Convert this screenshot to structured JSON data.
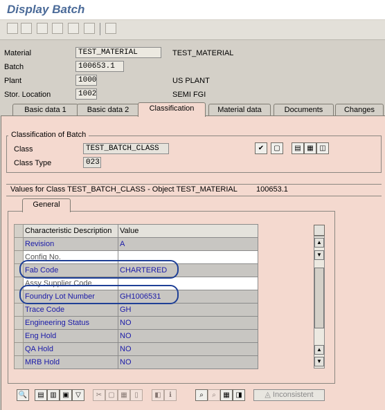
{
  "title": "Display Batch",
  "header": {
    "material_label": "Material",
    "material_value": "TEST_MATERIAL",
    "material_desc": "TEST_MATERIAL",
    "batch_label": "Batch",
    "batch_value": "100653.1",
    "plant_label": "Plant",
    "plant_value": "1000",
    "plant_desc": "US PLANT",
    "storloc_label": "Stor. Location",
    "storloc_value": "1002",
    "storloc_desc": "SEMI FGI"
  },
  "tabs": [
    "Basic data 1",
    "Basic data 2",
    "Classification",
    "Material data",
    "Documents",
    "Changes"
  ],
  "active_tab": "Classification",
  "classification": {
    "group_title": "Classification of Batch",
    "class_label": "Class",
    "class_value": "TEST_BATCH_CLASS",
    "class_type_label": "Class Type",
    "class_type_value": "023"
  },
  "values_line": {
    "text": "Values for Class TEST_BATCH_CLASS - Object TEST_MATERIAL",
    "batch": "100653.1"
  },
  "general_tab": "General",
  "table": {
    "headers": [
      "Characteristic Description",
      "Value"
    ],
    "rows": [
      {
        "desc": "Revision",
        "value": "A"
      },
      {
        "desc": "Config No.",
        "value": ""
      },
      {
        "desc": "Fab Code",
        "value": "CHARTERED"
      },
      {
        "desc": "Assy Supplier Code",
        "value": ""
      },
      {
        "desc": "Foundry Lot Number",
        "value": "GH1006531"
      },
      {
        "desc": "Trace Code",
        "value": "GH"
      },
      {
        "desc": "Engineering Status",
        "value": "NO"
      },
      {
        "desc": "Eng Hold",
        "value": "NO"
      },
      {
        "desc": "QA Hold",
        "value": "NO"
      },
      {
        "desc": "MRB Hold",
        "value": "NO"
      }
    ]
  },
  "bottom": {
    "inconsistent_label": "Inconsistent"
  },
  "colors": {
    "panel": "#f4d9cf",
    "highlight_oval": "#1e3f96",
    "cell_text": "#1a1aa8",
    "title": "#4a6a98"
  }
}
